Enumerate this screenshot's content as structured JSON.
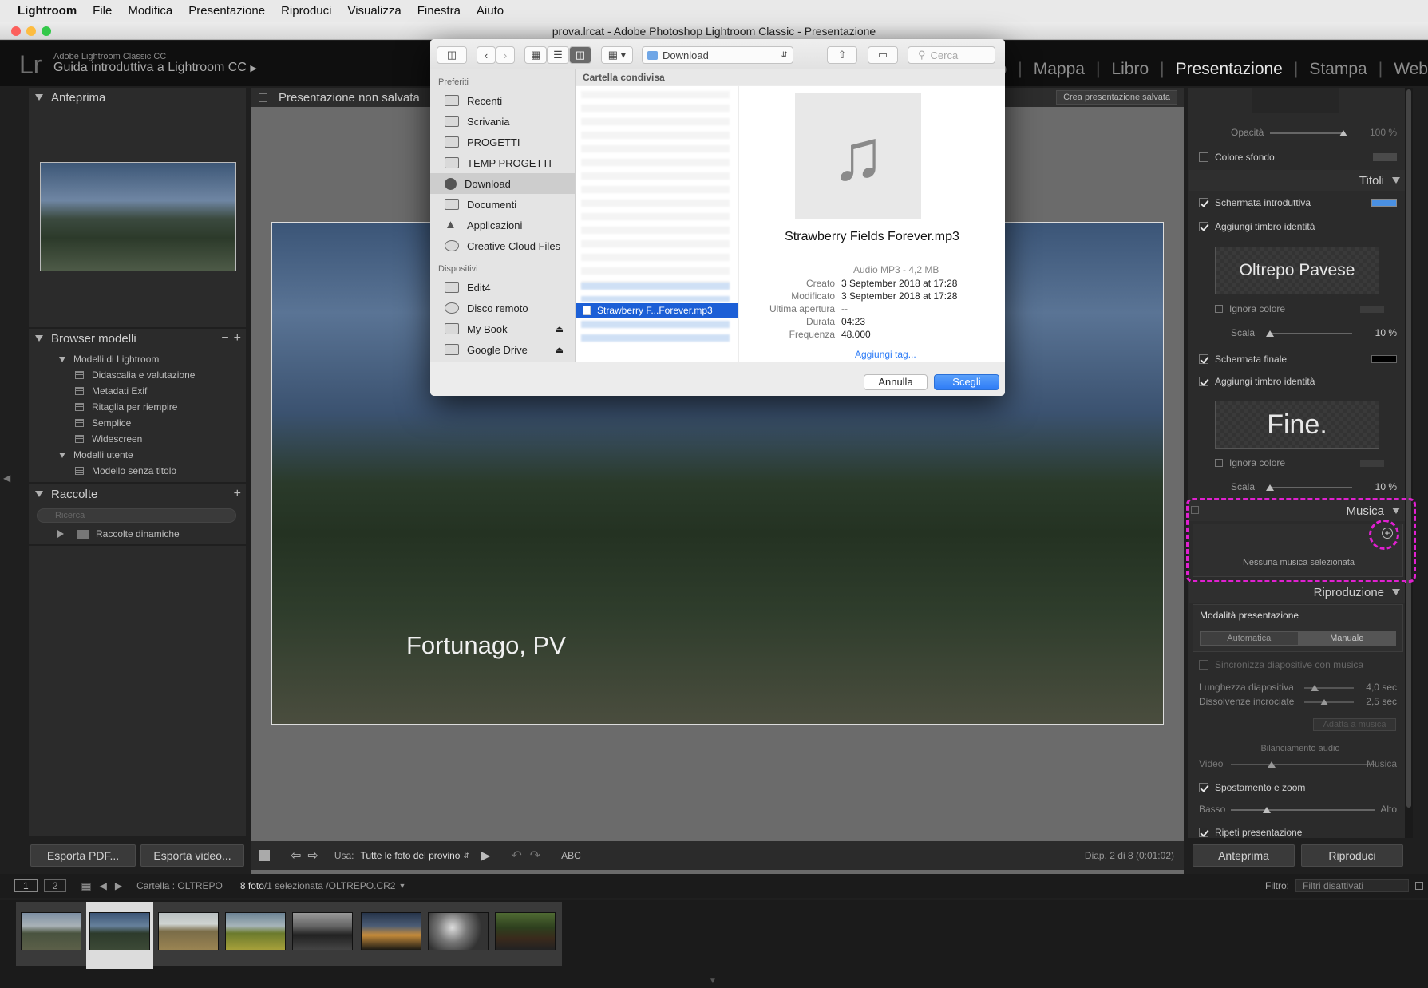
{
  "menubar": {
    "app": "Lightroom",
    "items": [
      "File",
      "Modifica",
      "Presentazione",
      "Riproduci",
      "Visualizza",
      "Finestra",
      "Aiuto"
    ]
  },
  "window": {
    "title": "prova.lrcat - Adobe Photoshop Lightroom Classic - Presentazione"
  },
  "lr_header": {
    "small": "Adobe Lightroom Classic CC",
    "title": "Guida introduttiva a Lightroom CC",
    "modules": [
      "o",
      "Mappa",
      "Libro",
      "Presentazione",
      "Stampa",
      "Web"
    ],
    "active_module": "Presentazione"
  },
  "left_panel": {
    "preview_title": "Anteprima",
    "browser_title": "Browser modelli",
    "tree": [
      {
        "label": "Modelli di Lightroom",
        "level": 0
      },
      {
        "label": "Didascalia e valutazione",
        "level": 1
      },
      {
        "label": "Metadati Exif",
        "level": 1
      },
      {
        "label": "Ritaglia per riempire",
        "level": 1
      },
      {
        "label": "Semplice",
        "level": 1
      },
      {
        "label": "Widescreen",
        "level": 1
      },
      {
        "label": "Modelli utente",
        "level": 0
      },
      {
        "label": "Modello senza titolo",
        "level": 1
      }
    ],
    "collections_title": "Raccolte",
    "search_placeholder": "Ricerca",
    "smart_collections": "Raccolte dinamiche",
    "export_pdf": "Esporta PDF...",
    "export_video": "Esporta video..."
  },
  "center": {
    "presentation_title": "Presentazione non salvata",
    "save_button": "Crea presentazione salvata",
    "caption": "Fortunago, PV",
    "toolbar": {
      "use_label": "Usa:",
      "use_value": "Tutte le foto del provino",
      "abc": "ABC",
      "status": "Diap. 2 di 8 (0:01:02)"
    }
  },
  "right_panel": {
    "opacity_label": "Opacità",
    "opacity_value": "100 %",
    "bg_color": "Colore sfondo",
    "titles_section": "Titoli",
    "intro_screen": "Schermata introduttiva",
    "add_identity": "Aggiungi timbro identità",
    "identity_text_1": "Oltrepo Pavese",
    "ignore_color": "Ignora colore",
    "scale_label": "Scala",
    "scale_value": "10 %",
    "final_screen": "Schermata finale",
    "identity_text_2": "Fine.",
    "music_section": "Musica",
    "no_music": "Nessuna musica selezionata",
    "playback_section": "Riproduzione",
    "mode_label": "Modalità presentazione",
    "mode_auto": "Automatica",
    "mode_manual": "Manuale",
    "sync_label": "Sincronizza diapositive con musica",
    "slide_len_label": "Lunghezza diapositiva",
    "slide_len_value": "4,0 sec",
    "fades_label": "Dissolvenze incrociate",
    "fades_value": "2,5 sec",
    "fit_music": "Adatta a musica",
    "audio_balance": "Bilanciamento audio",
    "video_label": "Video",
    "music_label": "Musica",
    "pan_zoom": "Spostamento e zoom",
    "low_label": "Basso",
    "high_label": "Alto",
    "repeat_label": "Ripeti presentazione",
    "preview_button": "Anteprima",
    "play_button": "Riproduci"
  },
  "filmstrip_bar": {
    "page1": "1",
    "page2": "2",
    "source_prefix": "Cartella : OLTREPO",
    "count": "8 foto",
    "selection": " /1 selezionata /OLTREPO.CR2",
    "filter_label": "Filtro:",
    "filter_value": "Filtri disattivati"
  },
  "dialog": {
    "location": "Download",
    "search_placeholder": "Cerca",
    "favorites_title": "Preferiti",
    "favorites": [
      "Recenti",
      "Scrivania",
      "PROGETTI",
      "TEMP PROGETTI",
      "Download",
      "Documenti",
      "Applicazioni",
      "Creative Cloud Files"
    ],
    "selected_favorite": "Download",
    "devices_title": "Dispositivi",
    "devices": [
      "Edit4",
      "Disco remoto",
      "My Book",
      "Google Drive"
    ],
    "column_header": "Cartella condivisa",
    "selected_file": "Strawberry F...Forever.mp3",
    "preview": {
      "filename": "Strawberry Fields Forever.mp3",
      "kind": "Audio MP3 - 4,2 MB",
      "rows": [
        {
          "label": "Creato",
          "value": "3 September 2018 at 17:28"
        },
        {
          "label": "Modificato",
          "value": "3 September 2018 at 17:28"
        },
        {
          "label": "Ultima apertura",
          "value": "--"
        },
        {
          "label": "Durata",
          "value": "04:23"
        },
        {
          "label": "Frequenza",
          "value": "48.000"
        }
      ],
      "add_tags": "Aggiungi tag..."
    },
    "cancel": "Annulla",
    "choose": "Scegli"
  },
  "colors": {
    "accent_blue": "#2e7cf6",
    "highlight_magenta": "#e020d0",
    "intro_swatch": "#4a90e2"
  }
}
